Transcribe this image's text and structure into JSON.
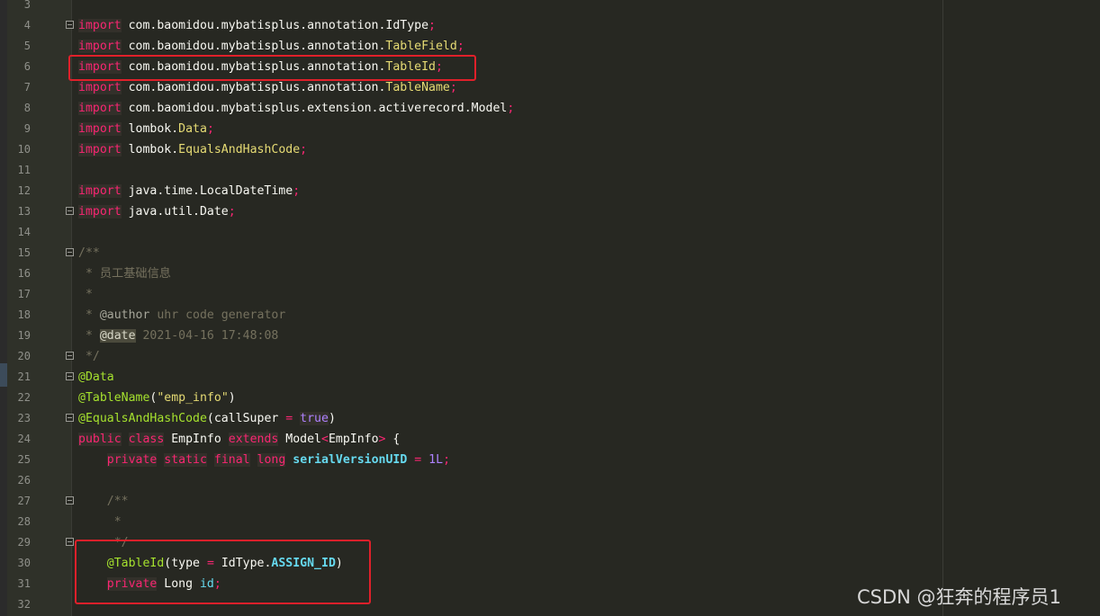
{
  "editor": {
    "lines": [
      {
        "n": "3",
        "segs": []
      },
      {
        "n": "4",
        "fold": true,
        "segs": [
          [
            "import",
            "kw"
          ],
          " com.baomidou.mybatisplus.annotation.IdType",
          [
            ";",
            "sym"
          ]
        ]
      },
      {
        "n": "5",
        "segs": [
          [
            "import",
            "kw"
          ],
          " com.baomidou.mybatisplus.annotation.",
          [
            "TableField",
            "cls"
          ],
          [
            ";",
            "sym"
          ]
        ]
      },
      {
        "n": "6",
        "segs": [
          [
            "import",
            "kw"
          ],
          " com.baomidou.mybatisplus.annotation.",
          [
            "TableId",
            "cls"
          ],
          [
            ";",
            "sym"
          ]
        ]
      },
      {
        "n": "7",
        "segs": [
          [
            "import",
            "kw"
          ],
          " com.baomidou.mybatisplus.annotation.",
          [
            "TableName",
            "cls"
          ],
          [
            ";",
            "sym"
          ]
        ]
      },
      {
        "n": "8",
        "segs": [
          [
            "import",
            "kw"
          ],
          " com.baomidou.mybatisplus.extension.activerecord.Model",
          [
            ";",
            "sym"
          ]
        ]
      },
      {
        "n": "9",
        "segs": [
          [
            "import",
            "kw"
          ],
          " lombok.",
          [
            "Data",
            "cls"
          ],
          [
            ";",
            "sym"
          ]
        ]
      },
      {
        "n": "10",
        "segs": [
          [
            "import",
            "kw"
          ],
          " lombok.",
          [
            "EqualsAndHashCode",
            "cls"
          ],
          [
            ";",
            "sym"
          ]
        ]
      },
      {
        "n": "11",
        "segs": []
      },
      {
        "n": "12",
        "segs": [
          [
            "import",
            "kw"
          ],
          " java.time.LocalDateTime",
          [
            ";",
            "sym"
          ]
        ]
      },
      {
        "n": "13",
        "fold": true,
        "segs": [
          [
            "import",
            "kw"
          ],
          " java.util.Date",
          [
            ";",
            "sym"
          ]
        ]
      },
      {
        "n": "14",
        "segs": []
      },
      {
        "n": "15",
        "fold": true,
        "segs": [
          [
            "/**",
            "cmt"
          ]
        ]
      },
      {
        "n": "16",
        "segs": [
          [
            " * 员工基础信息",
            "cmt"
          ]
        ]
      },
      {
        "n": "17",
        "segs": [
          [
            " *",
            "cmt"
          ]
        ]
      },
      {
        "n": "18",
        "segs": [
          [
            " * ",
            "cmt"
          ],
          [
            "@author",
            "ann2"
          ],
          [
            " uhr code generator",
            "cmt"
          ]
        ]
      },
      {
        "n": "19",
        "segs": [
          [
            " * ",
            "cmt"
          ],
          [
            "@date",
            "tag"
          ],
          [
            " 2021-04-16 17:48:08",
            "cmt"
          ]
        ]
      },
      {
        "n": "20",
        "fold": true,
        "segs": [
          [
            " */",
            "cmt"
          ]
        ]
      },
      {
        "n": "21",
        "fold": true,
        "segs": [
          [
            "@Data",
            "ann"
          ]
        ]
      },
      {
        "n": "22",
        "segs": [
          [
            "@TableName",
            "ann"
          ],
          "(",
          [
            "\"emp_info\"",
            "str"
          ],
          ")"
        ]
      },
      {
        "n": "23",
        "fold": true,
        "segs": [
          [
            "@EqualsAndHashCode",
            "ann"
          ],
          "(callSuper ",
          [
            "=",
            "sym"
          ],
          " ",
          [
            "true",
            "bool"
          ],
          ")"
        ]
      },
      {
        "n": "24",
        "segs": [
          [
            "public",
            "kw"
          ],
          " ",
          [
            "class",
            "kw"
          ],
          " EmpInfo ",
          [
            "extends",
            "kw"
          ],
          " Model",
          [
            "<",
            "sym"
          ],
          "EmpInfo",
          [
            ">",
            "sym"
          ],
          " {"
        ]
      },
      {
        "n": "25",
        "segs": [
          "    ",
          [
            "private",
            "kw"
          ],
          " ",
          [
            "static",
            "kw"
          ],
          " ",
          [
            "final",
            "kw"
          ],
          " ",
          [
            "long",
            "kw"
          ],
          " ",
          [
            "serialVersionUID",
            "fld"
          ],
          " ",
          [
            "=",
            "sym"
          ],
          " ",
          [
            "1L",
            "num"
          ],
          [
            ";",
            "sym"
          ]
        ]
      },
      {
        "n": "26",
        "segs": []
      },
      {
        "n": "27",
        "fold": true,
        "segs": [
          [
            "    /**",
            "cmt"
          ]
        ]
      },
      {
        "n": "28",
        "segs": [
          [
            "     *",
            "cmt"
          ]
        ]
      },
      {
        "n": "29",
        "fold": true,
        "segs": [
          [
            "     */",
            "cmt"
          ]
        ]
      },
      {
        "n": "30",
        "segs": [
          "    ",
          [
            "@TableId",
            "ann"
          ],
          "(type ",
          [
            "=",
            "sym"
          ],
          " IdType.",
          [
            "ASSIGN_ID",
            "fld"
          ],
          ")"
        ]
      },
      {
        "n": "31",
        "segs": [
          "    ",
          [
            "private",
            "kw"
          ],
          " Long ",
          [
            "id",
            "fld2"
          ],
          [
            ";",
            "sym"
          ]
        ]
      },
      {
        "n": "32",
        "segs": []
      }
    ]
  },
  "watermark": "CSDN @狂奔的程序员1"
}
